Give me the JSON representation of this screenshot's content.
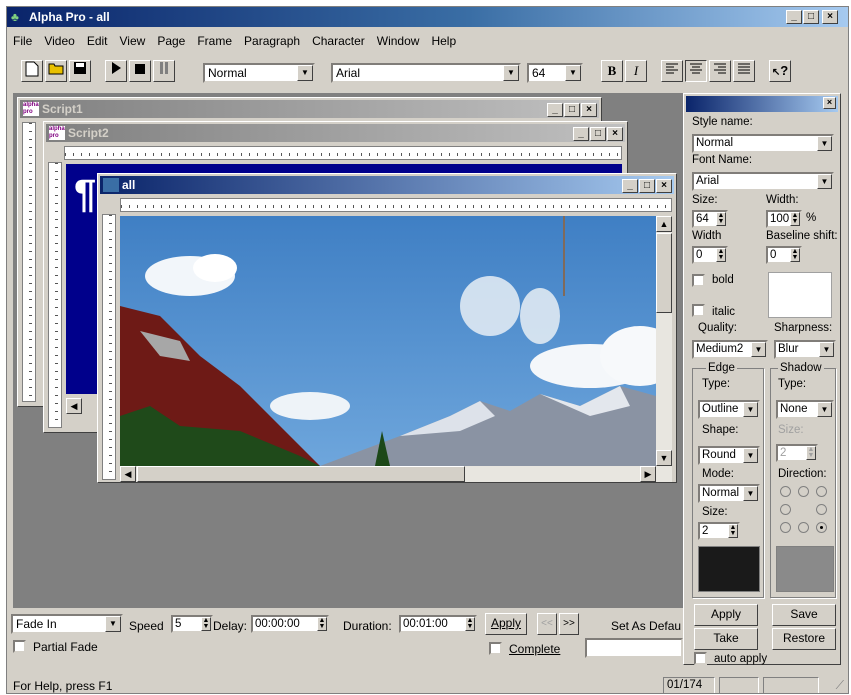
{
  "app": {
    "title": "Alpha Pro - all",
    "window_buttons": [
      "_",
      "□",
      "×"
    ]
  },
  "menu": [
    {
      "label": "File"
    },
    {
      "label": "Video"
    },
    {
      "label": "Edit"
    },
    {
      "label": "View"
    },
    {
      "label": "Page"
    },
    {
      "label": "Frame"
    },
    {
      "label": "Paragraph"
    },
    {
      "label": "Character"
    },
    {
      "label": "Window"
    },
    {
      "label": "Help"
    }
  ],
  "toolbar": {
    "style_value": "Normal",
    "font_value": "Arial",
    "size_value": "64",
    "bold_glyph": "B",
    "italic_glyph": "I",
    "help_glyph": "?"
  },
  "windows": {
    "script1_title": "Script1",
    "script2_title": "Script2",
    "all_title": "all",
    "logo_text": "alpha pro"
  },
  "style_panel": {
    "style_name_label": "Style name:",
    "style_name_value": "Normal",
    "font_name_label": "Font Name:",
    "font_name_value": "Arial",
    "size_label": "Size:",
    "size_value": "64",
    "width_label": "Width:",
    "width_value": "100",
    "width_unit": "%",
    "width2_label": "Width",
    "width2_value": "0",
    "baseline_label": "Baseline shift:",
    "baseline_value": "0",
    "bold_label": "bold",
    "italic_label": "italic",
    "quality_label": "Quality:",
    "quality_value": "Medium2",
    "sharpness_label": "Sharpness:",
    "sharpness_value": "Blur",
    "edge_group": "Edge",
    "edge_type_label": "Type:",
    "edge_type_value": "Outline",
    "shape_label": "Shape:",
    "shape_value": "Round",
    "mode_label": "Mode:",
    "mode_value": "Normal",
    "edge_size_label": "Size:",
    "edge_size_value": "2",
    "shadow_group": "Shadow",
    "shadow_type_label": "Type:",
    "shadow_type_value": "None",
    "shadow_size_label": "Size:",
    "shadow_size_value": "2",
    "direction_label": "Direction:",
    "edge_color": "#1a1a1a",
    "shadow_color": "#8a8a8a",
    "apply_label": "Apply",
    "save_label": "Save",
    "take_label": "Take",
    "restore_label": "Restore",
    "auto_apply_label": "auto apply"
  },
  "transition": {
    "effect_value": "Fade In",
    "speed_label": "Speed",
    "speed_value": "5",
    "delay_label": "Delay:",
    "delay_value": "00:00:00",
    "duration_label": "Duration:",
    "duration_value": "00:01:00",
    "apply_label": "Apply",
    "prev_label": "<<",
    "next_label": ">>",
    "set_default_label": "Set As Defau",
    "partial_fade_label": "Partial Fade",
    "complete_label": "Complete"
  },
  "status": {
    "help_text": "For Help, press F1",
    "page_counter": "01/174"
  }
}
